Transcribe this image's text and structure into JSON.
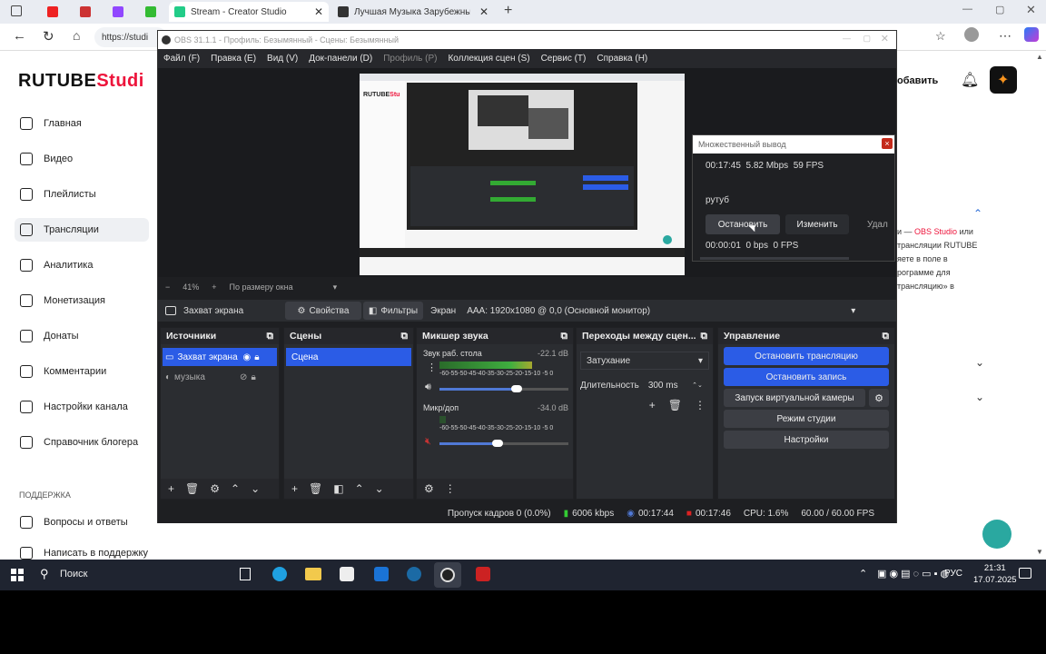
{
  "browser": {
    "tabs": [
      {
        "label": "Stream - Creator Studio"
      },
      {
        "label": "Лучшая Музыка Зарубежные пе"
      }
    ],
    "url": "https://studi"
  },
  "rutube": {
    "logo": "RUTUBE",
    "logo_suffix": "Studi",
    "sidebar": [
      {
        "label": "Главная",
        "icon": "home-icon"
      },
      {
        "label": "Видео",
        "icon": "video-icon"
      },
      {
        "label": "Плейлисты",
        "icon": "playlist-icon"
      },
      {
        "label": "Трансляции",
        "icon": "broadcast-icon"
      },
      {
        "label": "Аналитика",
        "icon": "analytics-icon"
      },
      {
        "label": "Монетизация",
        "icon": "money-icon"
      },
      {
        "label": "Донаты",
        "icon": "donate-icon"
      },
      {
        "label": "Комментарии",
        "icon": "comment-icon"
      },
      {
        "label": "Настройки канала",
        "icon": "settings-icon"
      },
      {
        "label": "Справочник блогера",
        "icon": "book-icon"
      }
    ],
    "support_heading": "ПОДДЕРЖКА",
    "support_items": [
      "Вопросы и ответы",
      "Написать в поддержку"
    ],
    "add_button": "обавить",
    "right_text": [
      "и — ",
      "OBS Studio",
      " или",
      "трансляции RUTUBE",
      "яете в поле в",
      "рограмме для",
      "трансляцию» в"
    ]
  },
  "obs": {
    "title": "OBS 31.1.1 - Профиль: Безымянный - Сцены: Безымянный",
    "menu": [
      {
        "label": "Файл (F)",
        "dim": false
      },
      {
        "label": "Правка (E)",
        "dim": false
      },
      {
        "label": "Вид (V)",
        "dim": false
      },
      {
        "label": "Док-панели (D)",
        "dim": false
      },
      {
        "label": "Профиль (P)",
        "dim": true
      },
      {
        "label": "Коллекция сцен (S)",
        "dim": false
      },
      {
        "label": "Сервис (T)",
        "dim": false
      },
      {
        "label": "Справка (H)",
        "dim": false
      }
    ],
    "zoom": {
      "minus": "−",
      "value": "41%",
      "plus": "+",
      "fit": "По размеру окна"
    },
    "source_bar": {
      "name": "Захват экрана",
      "properties": "Свойства",
      "filters": "Фильтры",
      "screen_label": "Экран",
      "screen_value": "AAA: 1920x1080 @ 0,0 (Основной монитор)"
    },
    "sources": {
      "title": "Источники",
      "items": [
        "Захват экрана",
        "музыка"
      ]
    },
    "scenes": {
      "title": "Сцены",
      "items": [
        "Сцена"
      ]
    },
    "mixer": {
      "title": "Микшер звука",
      "channels": [
        {
          "name": "Звук раб. стола",
          "db": "-22.1 dB",
          "level": 0.72,
          "volume": 0.6
        },
        {
          "name": "Микр/доп",
          "db": "-34.0 dB",
          "level": 0.05,
          "volume": 0.45
        }
      ],
      "scale": "-60-55-50-45-40-35-30-25-20-15-10 -5 0"
    },
    "transitions": {
      "title": "Переходы между сцен...",
      "type": "Затухание",
      "duration_label": "Длительность",
      "duration_value": "300 ms"
    },
    "controls": {
      "title": "Управление",
      "buttons": [
        {
          "label": "Остановить трансляцию",
          "active": true
        },
        {
          "label": "Остановить запись",
          "active": true
        },
        {
          "label": "Запуск виртуальной камеры",
          "active": false
        },
        {
          "label": "Режим студии",
          "active": false
        },
        {
          "label": "Настройки",
          "active": false
        }
      ]
    },
    "status": {
      "dropped": "Пропуск кадров 0 (0.0%)",
      "bitrate": "6006 kbps",
      "stream_time": "00:17:44",
      "rec_time": "00:17:46",
      "cpu": "CPU: 1.6%",
      "fps": "60.00 / 60.00 FPS"
    }
  },
  "dialog": {
    "title": "Множественный вывод",
    "close": "×",
    "row1": "00:17:45  5.82 Mbps  59 FPS",
    "name": "рутуб",
    "stop": "Остановить",
    "edit": "Изменить",
    "delete": "Удал",
    "row2": "00:00:01  0 bps  0 FPS"
  },
  "taskbar": {
    "search": "Поиск",
    "lang": "РУС",
    "time": "21:31",
    "date": "17.07.2025"
  },
  "colors": {
    "obs_blue": "#2b5ce6",
    "rutube_red": "#ed143b",
    "obs_bg": "#1e1f22"
  }
}
